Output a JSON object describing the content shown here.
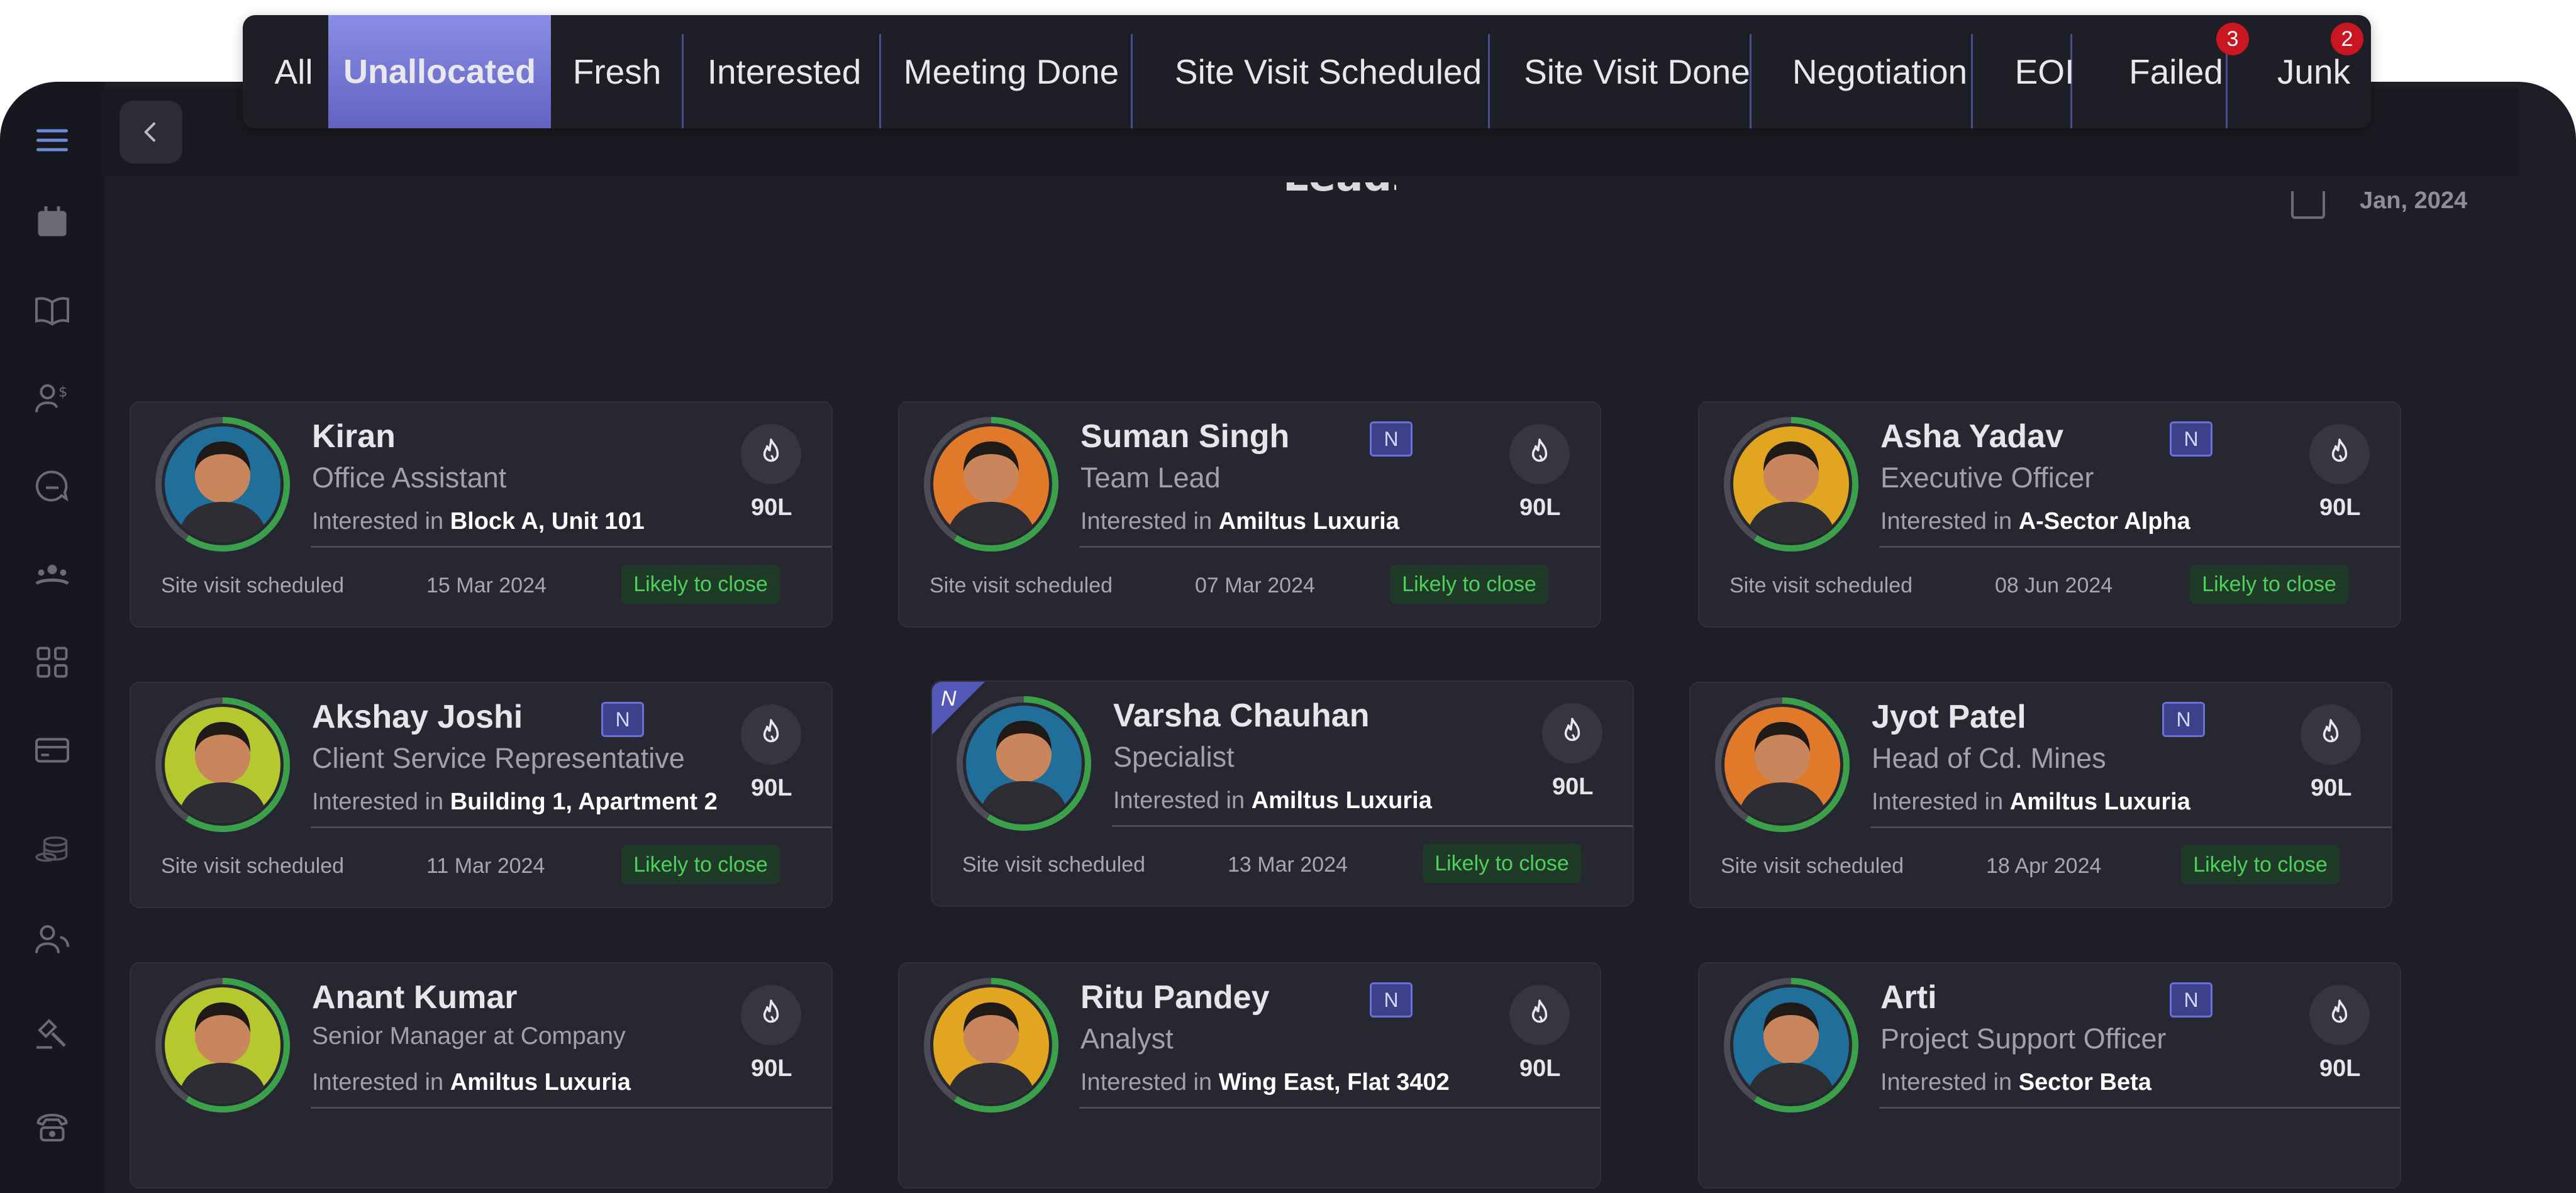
{
  "page": {
    "title": "Leads",
    "date": "Jan, 2024"
  },
  "tabs": [
    {
      "label": "All",
      "active": false
    },
    {
      "label": "Unallocated",
      "active": true
    },
    {
      "label": "Fresh",
      "active": false
    },
    {
      "label": "Interested",
      "active": false
    },
    {
      "label": "Meeting Done",
      "active": false
    },
    {
      "label": "Site Visit Scheduled",
      "active": false
    },
    {
      "label": "Site Visit Done",
      "active": false
    },
    {
      "label": "Negotiation",
      "active": false
    },
    {
      "label": "EOI",
      "active": false
    },
    {
      "label": "Failed",
      "active": false,
      "badge": "3"
    },
    {
      "label": "Junk",
      "active": false,
      "badge": "2"
    }
  ],
  "sidebar": {
    "icons": [
      "menu-icon",
      "calendar-icon",
      "book-icon",
      "user-dollar-icon",
      "chat-icon",
      "team-icon",
      "grid-icon",
      "card-icon",
      "coins-icon",
      "users-icon",
      "auction-icon",
      "phone-icon"
    ]
  },
  "view_toggle": {
    "options": [
      "list-view-icon",
      "grid-view-icon"
    ],
    "active": "list-view-icon"
  },
  "leads": [
    {
      "name": "Kiran",
      "role": "Office Assistant",
      "interest_prefix": "Interested in",
      "interest": "Block A, Unit 101",
      "price": "90L",
      "status": "Site visit scheduled",
      "date": "15 Mar 2024",
      "tag": "Likely to close",
      "new": false,
      "avatar_color": "#1f6f9a",
      "ring": "#3aa14a"
    },
    {
      "name": "Suman Singh",
      "role": "Team Lead",
      "interest_prefix": "Interested in",
      "interest": "Amiltus Luxuria",
      "price": "90L",
      "status": "Site visit scheduled",
      "date": "07 Mar 2024",
      "tag": "Likely to close",
      "new": true,
      "new_label": "N",
      "avatar_color": "#e07a2a",
      "ring": "#3aa14a"
    },
    {
      "name": "Asha Yadav",
      "role": "Executive Officer",
      "interest_prefix": "Interested in",
      "interest": "A-Sector Alpha",
      "price": "90L",
      "status": "Site visit scheduled",
      "date": "08 Jun 2024",
      "tag": "Likely to close",
      "new": true,
      "new_label": "N",
      "avatar_color": "#e2a520",
      "ring": "#3aa14a"
    },
    {
      "name": "Akshay Joshi",
      "role": "Client Service Representative",
      "interest_prefix": "Interested in",
      "interest": "Building 1, Apartment 2",
      "price": "90L",
      "status": "Site visit scheduled",
      "date": "11 Mar 2024",
      "tag": "Likely to close",
      "new": true,
      "new_label": "N",
      "avatar_color": "#b5c92f",
      "ring": "#3aa14a"
    },
    {
      "name": "Varsha Chauhan",
      "role": "Specialist",
      "interest_prefix": "Interested in",
      "interest": "Amiltus Luxuria",
      "price": "90L",
      "status": "Site visit scheduled",
      "date": "13 Mar 2024",
      "tag": "Likely to close",
      "new": false,
      "corner": "N",
      "avatar_color": "#1f6f9a",
      "ring": "#3aa14a"
    },
    {
      "name": "Jyot Patel",
      "role": "Head of Cd. Mines",
      "interest_prefix": "Interested in",
      "interest": "Amiltus Luxuria",
      "price": "90L",
      "status": "Site visit scheduled",
      "date": "18 Apr 2024",
      "tag": "Likely to close",
      "new": true,
      "new_label": "N",
      "avatar_color": "#e07a2a",
      "ring": "#3aa14a"
    },
    {
      "name": "Anant Kumar",
      "role": "Senior Manager at Company",
      "interest_prefix": "Interested in",
      "interest": "Amiltus Luxuria",
      "price": "90L",
      "new": false,
      "avatar_color": "#b5c92f",
      "ring": "#3aa14a"
    },
    {
      "name": "Ritu Pandey",
      "role": "Analyst",
      "interest_prefix": "Interested in",
      "interest": "Wing East, Flat 3402",
      "price": "90L",
      "new": true,
      "new_label": "N",
      "avatar_color": "#e2a520",
      "ring": "#3aa14a"
    },
    {
      "name": "Arti",
      "role": "Project Support Officer",
      "interest_prefix": "Interested in",
      "interest": "Sector Beta",
      "price": "90L",
      "new": true,
      "new_label": "N",
      "avatar_color": "#1f6f9a",
      "ring": "#3aa14a"
    }
  ]
}
